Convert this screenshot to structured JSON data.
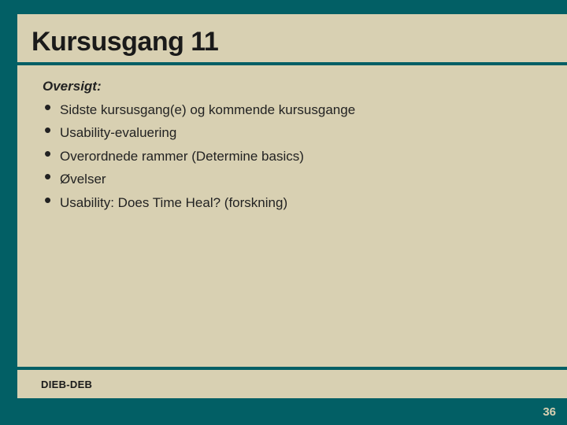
{
  "slide": {
    "title": "Kursusgang 11",
    "subheading": "Oversigt:",
    "bullets": [
      "Sidste kursusgang(e) og kommende kursusgange",
      "Usability-evaluering",
      "Overordnede rammer (Determine basics)",
      "Øvelser",
      "Usability: Does Time Heal? (forskning)"
    ],
    "footer": "DIEB-DEB",
    "page_number": "36"
  }
}
